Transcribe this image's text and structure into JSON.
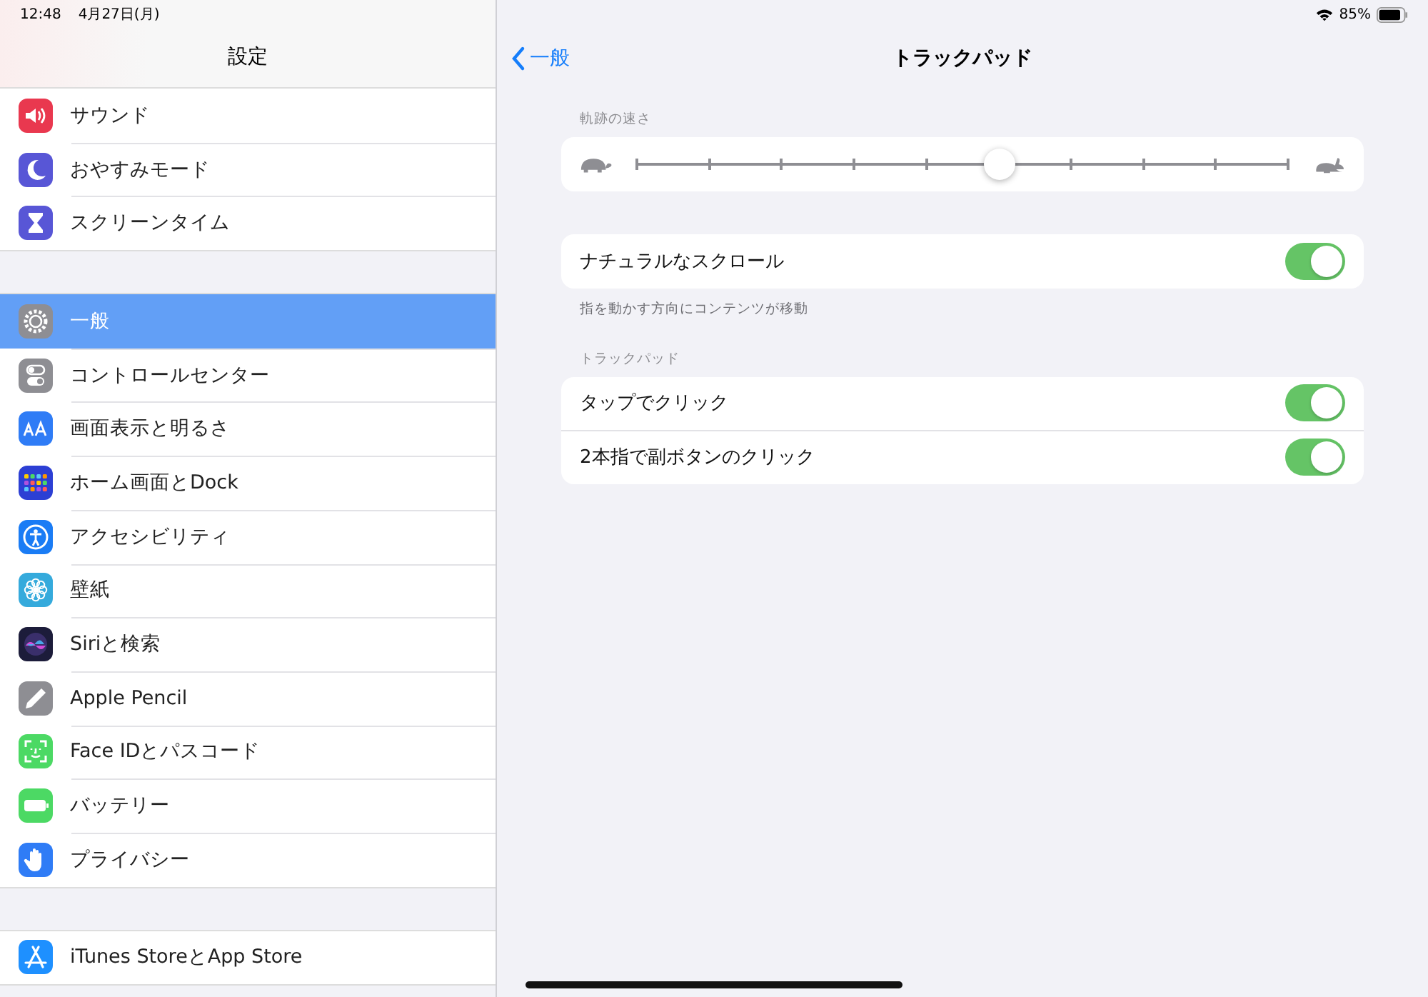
{
  "status_bar": {
    "time": "12:48",
    "date": "4月27日(月)",
    "battery": "85%"
  },
  "sidebar": {
    "title": "設定",
    "groups": [
      {
        "items": [
          {
            "label": "サウンド",
            "selected": false
          },
          {
            "label": "おやすみモード",
            "selected": false
          },
          {
            "label": "スクリーンタイム",
            "selected": false
          }
        ]
      },
      {
        "items": [
          {
            "label": "一般",
            "selected": true
          },
          {
            "label": "コントロールセンター",
            "selected": false
          },
          {
            "label": "画面表示と明るさ",
            "selected": false
          },
          {
            "label": "ホーム画面とDock",
            "selected": false
          },
          {
            "label": "アクセシビリティ",
            "selected": false
          },
          {
            "label": "壁紙",
            "selected": false
          },
          {
            "label": "Siriと検索",
            "selected": false
          },
          {
            "label": "Apple Pencil",
            "selected": false
          },
          {
            "label": "Face IDとパスコード",
            "selected": false
          },
          {
            "label": "バッテリー",
            "selected": false
          },
          {
            "label": "プライバシー",
            "selected": false
          }
        ]
      },
      {
        "items": [
          {
            "label": "iTunes StoreとApp Store",
            "selected": false
          }
        ]
      }
    ]
  },
  "nav": {
    "back": "一般",
    "title": "トラックパッド"
  },
  "speed": {
    "header": "軌跡の速さ",
    "level": 0.556
  },
  "natural_scroll": {
    "label": "ナチュラルなスクロール",
    "on": true,
    "footer": "指を動かす方向にコンテンツが移動"
  },
  "trackpad": {
    "header": "トラックパッド",
    "rows": [
      {
        "label": "タップでクリック",
        "on": true
      },
      {
        "label": "2本指で副ボタンのクリック",
        "on": true
      }
    ]
  }
}
